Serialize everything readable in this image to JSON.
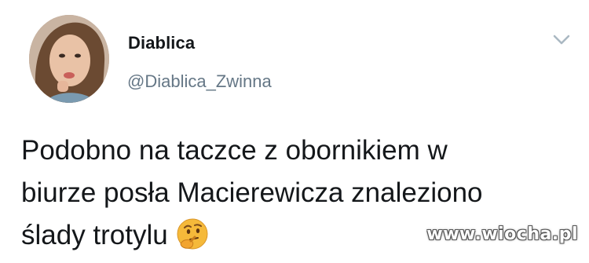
{
  "tweet": {
    "author": {
      "display_name": "Diablica",
      "handle": "@Diablica_Zwinna",
      "avatar_icon": "profile-photo"
    },
    "menu_icon": "chevron-down-icon",
    "text_lines": [
      "Podobno na taczce z obornikiem w",
      "biurze posła Macierewicza znaleziono",
      "ślady trotylu"
    ],
    "emoji": "thinking-face-emoji"
  },
  "watermark": "www.wiocha.pl"
}
